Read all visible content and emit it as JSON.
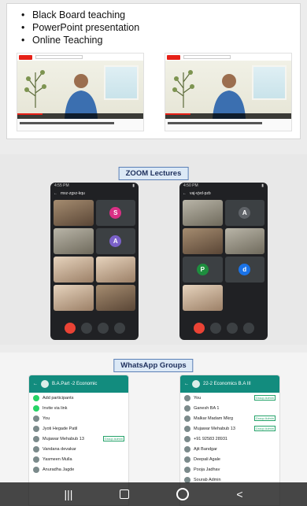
{
  "teaching": {
    "methods": [
      "Black Board teaching",
      "PowerPoint presentation",
      "Online Teaching"
    ],
    "video_brand": "YouTube"
  },
  "zoom": {
    "title": "ZOOM Lectures"
  },
  "whatsapp": {
    "title": "WhatsApp Groups"
  },
  "meet_left": {
    "time": "4:55 PM",
    "meeting": "mxz-zgxz-kqu",
    "tiles": [
      {
        "kind": "video",
        "tone": "d"
      },
      {
        "kind": "avatar",
        "letter": "S",
        "color": "#d93085"
      },
      {
        "kind": "video",
        "tone": "g"
      },
      {
        "kind": "avatar",
        "letter": "A",
        "color": "#7b61c9"
      },
      {
        "kind": "video",
        "tone": "l"
      },
      {
        "kind": "video",
        "tone": "l"
      },
      {
        "kind": "video",
        "tone": "l"
      },
      {
        "kind": "video",
        "tone": "d"
      }
    ]
  },
  "meet_right": {
    "time": "4:50 PM",
    "meeting": "vaj-vjvd-pzb",
    "tiles": [
      {
        "kind": "video",
        "tone": "g"
      },
      {
        "kind": "avatar",
        "letter": "A",
        "color": "#5f6368"
      },
      {
        "kind": "video",
        "tone": "d"
      },
      {
        "kind": "video",
        "tone": "g"
      },
      {
        "kind": "avatar",
        "letter": "P",
        "color": "#1e8e3e"
      },
      {
        "kind": "avatar",
        "letter": "d",
        "color": "#1a73e8"
      },
      {
        "kind": "video",
        "tone": "l"
      }
    ]
  },
  "wa_left": {
    "group": "B.A.Part -2 Economic",
    "rows": [
      {
        "name": "Add participants",
        "green": true
      },
      {
        "name": "Invite via link",
        "green": true
      },
      {
        "name": "You",
        "tag": ""
      },
      {
        "name": "Jyoti Hegade Patil",
        "tag": ""
      },
      {
        "name": "Mujawar Mehabub 13",
        "tag": "Group Admin"
      },
      {
        "name": "Vandana devakar",
        "tag": ""
      },
      {
        "name": "Yasmeen Mulla",
        "tag": ""
      },
      {
        "name": "Anuradha Jagde",
        "tag": ""
      }
    ]
  },
  "wa_right": {
    "group": "22-2 Economics B.A III",
    "rows": [
      {
        "name": "You",
        "tag": "Group Admin"
      },
      {
        "name": "Ganesh BA 1",
        "tag": ""
      },
      {
        "name": "Malkar Madam Mkrg",
        "tag": "Group Admin"
      },
      {
        "name": "Mujawar Mehabub 13",
        "tag": "Group Admin"
      },
      {
        "name": "+91 92583 28931",
        "tag": ""
      },
      {
        "name": "Ajit Bandgar",
        "tag": ""
      },
      {
        "name": "Deepali Agale",
        "tag": ""
      },
      {
        "name": "Pooja Jadhav",
        "tag": ""
      },
      {
        "name": "Sourab Admin",
        "tag": ""
      }
    ]
  }
}
